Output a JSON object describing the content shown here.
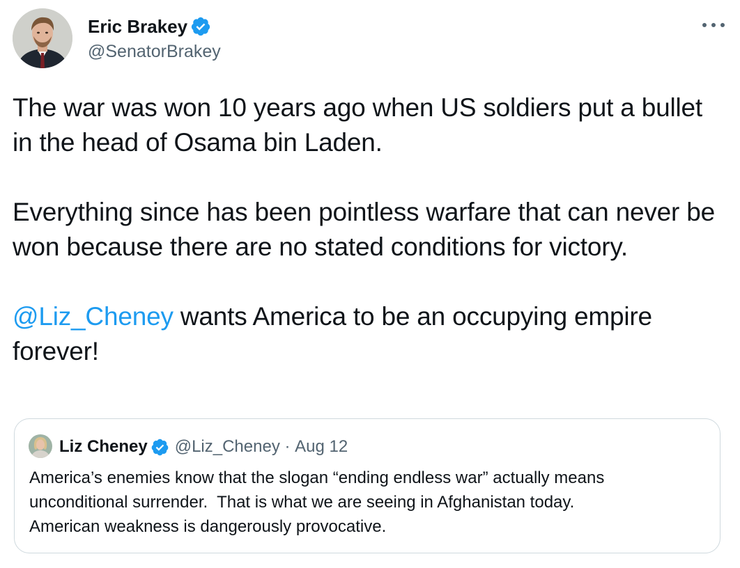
{
  "author": {
    "name": "Eric Brakey",
    "handle": "@SenatorBrakey",
    "verified": true
  },
  "more_icon": "more-horizontal-icon",
  "tweet": {
    "paragraph1": "The war was won 10 years ago when US soldiers put a bullet in the head of Osama bin Laden.",
    "paragraph2": "Everything since has been pointless warfare that can never be won because there are no stated conditions for victory.",
    "mention": "@Liz_Cheney",
    "paragraph3_rest": " wants America to be an occupying empire forever!"
  },
  "quoted": {
    "name": "Liz Cheney",
    "handle": "@Liz_Cheney",
    "separator": " · ",
    "date": "Aug 12",
    "verified": true,
    "text_line1": "America’s enemies know that the slogan “ending endless war” actually means",
    "text_line2": "unconditional surrender.  That is what we are seeing in Afghanistan today.",
    "text_line3": "American weakness is dangerously provocative."
  },
  "colors": {
    "link": "#1d9bf0",
    "secondary_text": "#536471",
    "border": "#cfd9de",
    "verified_badge": "#1d9bf0"
  }
}
